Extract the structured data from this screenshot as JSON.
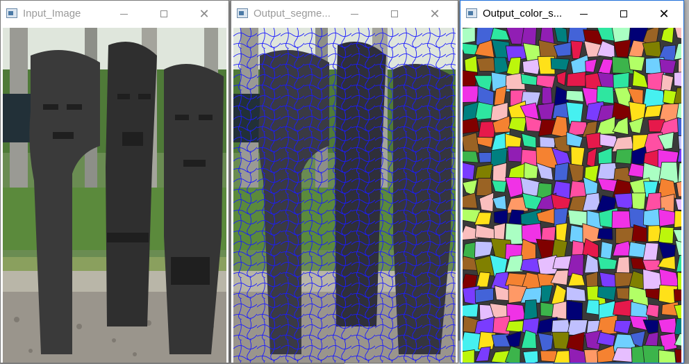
{
  "windows": [
    {
      "title": "Input_Image",
      "active": false
    },
    {
      "title": "Output_segme...",
      "active": false
    },
    {
      "title": "Output_color_s...",
      "active": true
    }
  ],
  "controls": {
    "minimize": "",
    "maximize": "",
    "close": "✕"
  },
  "icons": {
    "app": "opencv-window-icon",
    "minimize": "minimize-icon",
    "maximize": "maximize-icon",
    "close": "close-icon"
  },
  "colors": {
    "segment_boundary": "#1a1aff",
    "stone": "#3b3b3b",
    "foliage": "#5f8a3a"
  }
}
